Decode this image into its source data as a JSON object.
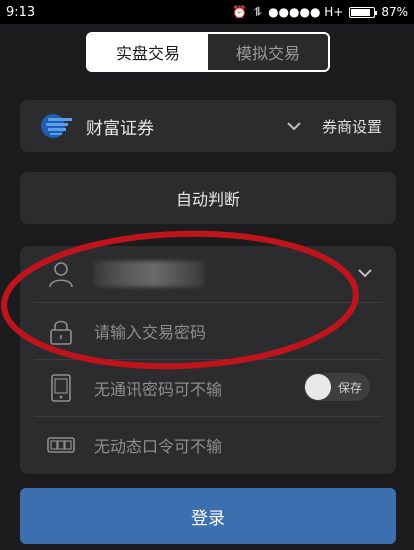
{
  "status_bar": {
    "time": "9:13",
    "carrier": "●●●●● H+",
    "battery": "87%",
    "battery_level": 0.87
  },
  "tabs": {
    "real": "实盘交易",
    "simulated": "模拟交易",
    "active": "real"
  },
  "broker": {
    "name": "财富证券",
    "settings_label": "券商设置"
  },
  "auto_detect_label": "自动判断",
  "form": {
    "password_placeholder": "请输入交易密码",
    "comm_password_label": "无通讯密码可不输",
    "save_label": "保存",
    "dynamic_token_label": "无动态口令可不输"
  },
  "login_label": "登录",
  "colors": {
    "background": "#1c1c1e",
    "card": "#2c2c2e",
    "login_button": "#3b6fb0",
    "annotation": "#c0141c"
  }
}
